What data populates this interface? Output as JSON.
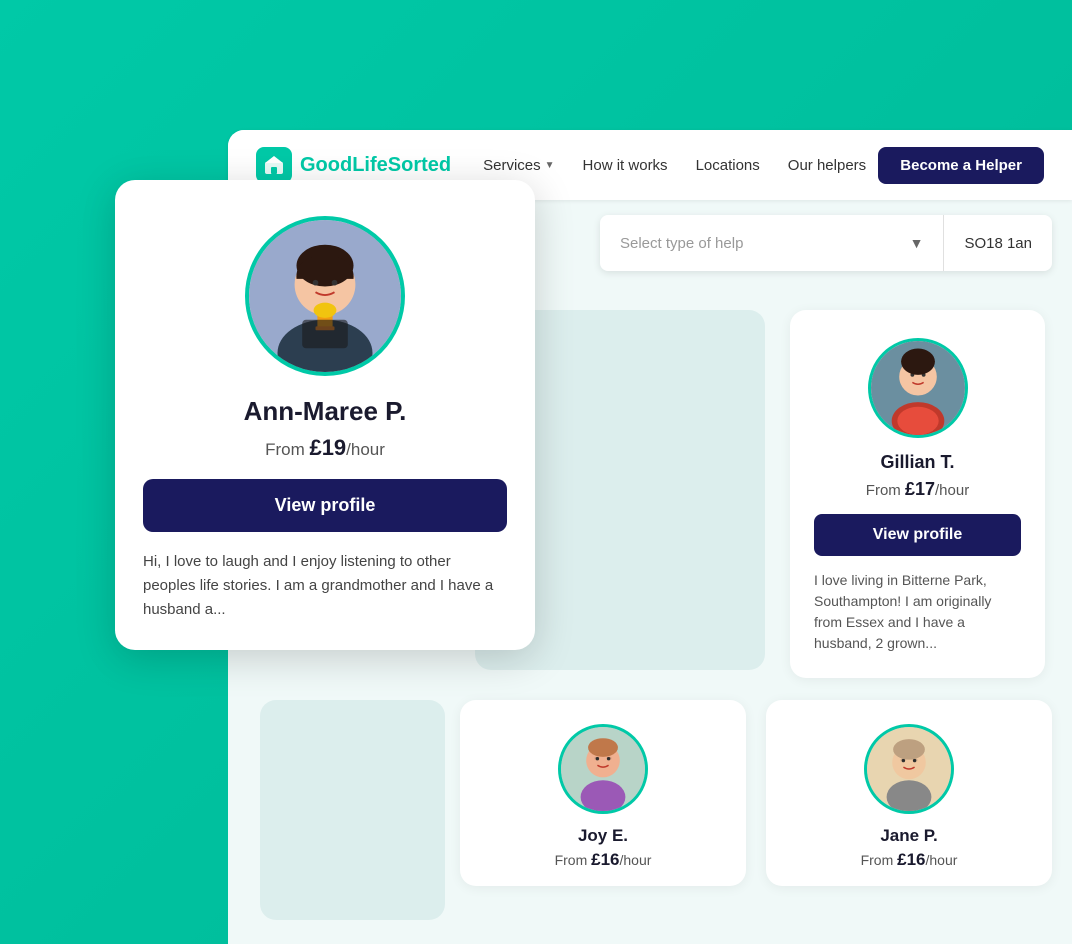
{
  "colors": {
    "teal": "#00c9a7",
    "navy": "#1a1a5e",
    "dark": "#1a1a2e",
    "text": "#555",
    "bg_light": "#f0f9f8"
  },
  "navbar": {
    "logo_text_dark": "GoodLife",
    "logo_text_accent": "Sorted",
    "nav_links": [
      {
        "label": "Services",
        "has_chevron": true
      },
      {
        "label": "How it works"
      },
      {
        "label": "Locations"
      },
      {
        "label": "Our helpers"
      }
    ],
    "cta_label": "Become a Helper"
  },
  "search": {
    "placeholder": "Select type of help",
    "location": "SO18 1an"
  },
  "popup_card": {
    "name": "Ann-Maree P.",
    "rate_prefix": "From ",
    "rate": "£19",
    "rate_suffix": "/hour",
    "view_profile_label": "View profile",
    "bio": "Hi, I love to laugh and I enjoy listening to other peoples life stories. I am a grandmother and I have a husband a..."
  },
  "main_cards": [
    {
      "name": "Gillian T.",
      "rate_prefix": "From ",
      "rate": "£17",
      "rate_suffix": "/hour",
      "view_profile_label": "View profile",
      "bio": "I love living in Bitterne Park, Southampton! I am originally from Essex and I have a husband, 2 grown...",
      "avatar_color": "#a0522d"
    }
  ],
  "bottom_cards": [
    {
      "name": "Joy E.",
      "rate_prefix": "From ",
      "rate": "£16",
      "rate_suffix": "/hour",
      "avatar_color": "#d4956a"
    },
    {
      "name": "Jane P.",
      "rate_prefix": "From ",
      "rate": "£16",
      "rate_suffix": "/hour",
      "avatar_color": "#c4a882"
    }
  ]
}
